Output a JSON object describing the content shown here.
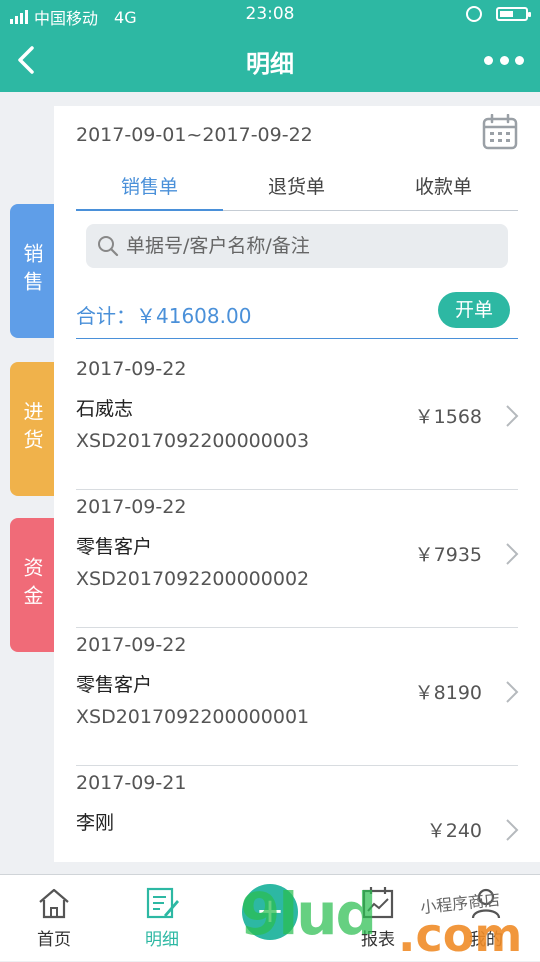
{
  "status_bar": {
    "carrier": "中国移动",
    "network": "4G",
    "time": "23:08",
    "battery_level": 0.55
  },
  "nav": {
    "title": "明细",
    "back_icon": "chevron-left-icon",
    "more_icon": "more-dots-icon"
  },
  "side_tabs": [
    {
      "label": "销售",
      "color": "#5f9ee8",
      "active": true
    },
    {
      "label": "进货",
      "color": "#f0b24b",
      "active": false
    },
    {
      "label": "资金",
      "color": "#f06b78",
      "active": false
    }
  ],
  "header": {
    "date_range": "2017-09-01~2017-09-22",
    "calendar_icon": "calendar-icon"
  },
  "tabs": [
    {
      "label": "销售单",
      "active": true
    },
    {
      "label": "退货单",
      "active": false
    },
    {
      "label": "收款单",
      "active": false
    }
  ],
  "search": {
    "placeholder": "单据号/客户名称/备注",
    "value": ""
  },
  "summary": {
    "total_label": "合计：￥41608.00",
    "new_button": "开单"
  },
  "orders": [
    {
      "date": "2017-09-22",
      "customer": "石威志",
      "order_no": "XSD2017092200000003",
      "amount": "￥1568"
    },
    {
      "date": "2017-09-22",
      "customer": "零售客户",
      "order_no": "XSD2017092200000002",
      "amount": "￥7935"
    },
    {
      "date": "2017-09-22",
      "customer": "零售客户",
      "order_no": "XSD2017092200000001",
      "amount": "￥8190"
    },
    {
      "date": "2017-09-21",
      "customer": "李刚",
      "order_no": "",
      "amount": "￥240"
    }
  ],
  "tab_bar": [
    {
      "label": "首页",
      "icon": "home-icon",
      "active": false
    },
    {
      "label": "明细",
      "icon": "document-edit-icon",
      "active": true
    },
    {
      "label": "",
      "icon": "plus-icon",
      "active": false
    },
    {
      "label": "报表",
      "icon": "report-chart-icon",
      "active": false
    },
    {
      "label": "我的",
      "icon": "user-icon",
      "active": false
    }
  ],
  "accent_color": "#2db8a3",
  "link_color": "#4a90d9",
  "watermark": {
    "text": "9lud.com",
    "small": "小程序商店"
  }
}
